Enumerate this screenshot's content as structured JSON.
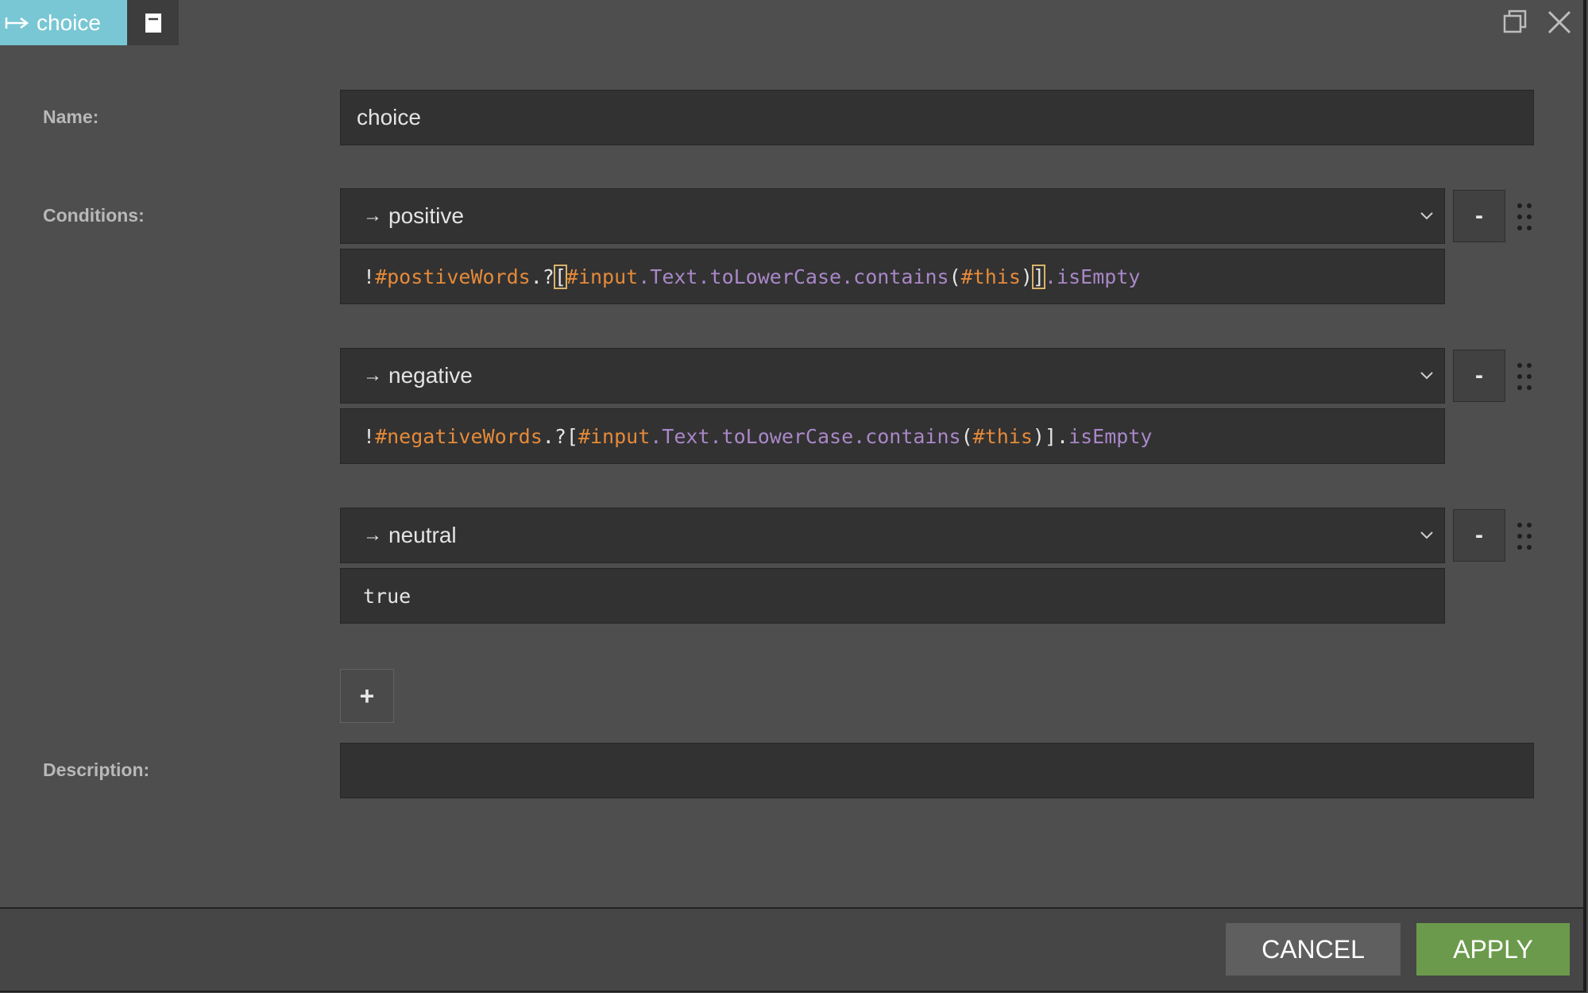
{
  "header": {
    "tab_label": "choice",
    "tab_icon": "split-arrow-icon",
    "doc_icon": "document-icon",
    "maximize_icon": "maximize-icon",
    "close_icon": "close-icon",
    "accent_color": "#79c7d4"
  },
  "form": {
    "name_label": "Name:",
    "name_value": "choice",
    "conditions_label": "Conditions:",
    "description_label": "Description:",
    "description_value": "",
    "add_label": "+",
    "remove_label": "-"
  },
  "conditions": [
    {
      "target_prefix": "→",
      "target": "positive",
      "expression_tokens": [
        {
          "t": "!",
          "c": "white"
        },
        {
          "t": "#postiveWords",
          "c": "orange"
        },
        {
          "t": ".?",
          "c": "white"
        },
        {
          "t": "[",
          "c": "bracket"
        },
        {
          "t": "#input",
          "c": "orange"
        },
        {
          "t": ".Text.toLowerCase.contains",
          "c": "purple"
        },
        {
          "t": "(",
          "c": "white"
        },
        {
          "t": "#this",
          "c": "orange"
        },
        {
          "t": ")",
          "c": "white"
        },
        {
          "t": "]",
          "c": "bracket"
        },
        {
          "t": ".isEmpty",
          "c": "purple"
        }
      ]
    },
    {
      "target_prefix": "→",
      "target": "negative",
      "expression_tokens": [
        {
          "t": "!",
          "c": "white"
        },
        {
          "t": "#negativeWords",
          "c": "orange"
        },
        {
          "t": ".?[",
          "c": "white"
        },
        {
          "t": "#input",
          "c": "orange"
        },
        {
          "t": ".Text.toLowerCase.contains",
          "c": "purple"
        },
        {
          "t": "(",
          "c": "white"
        },
        {
          "t": "#this",
          "c": "orange"
        },
        {
          "t": ")].",
          "c": "white"
        },
        {
          "t": "isEmpty",
          "c": "purple"
        }
      ]
    },
    {
      "target_prefix": "→",
      "target": "neutral",
      "expression_tokens": [
        {
          "t": "true",
          "c": "white"
        }
      ]
    }
  ],
  "footer": {
    "cancel_label": "CANCEL",
    "apply_label": "APPLY",
    "apply_color": "#6b9a4c"
  }
}
